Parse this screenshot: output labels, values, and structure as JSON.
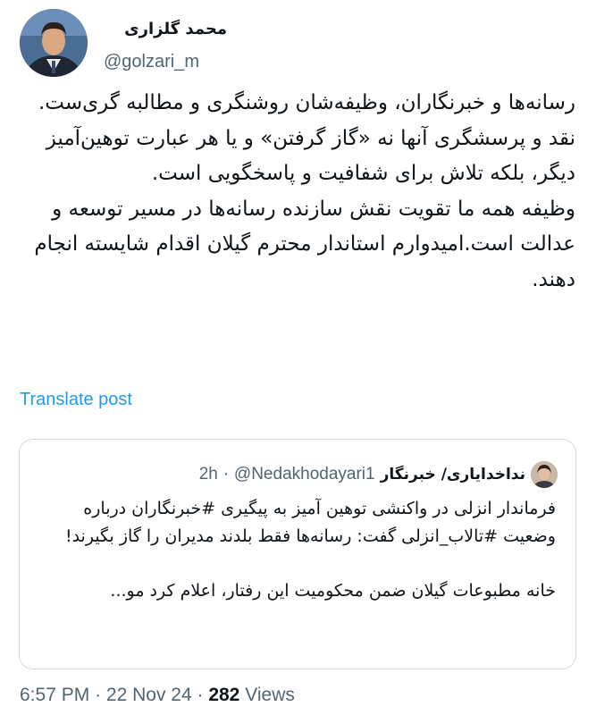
{
  "author": {
    "name": "محمد گلزاری",
    "handle": "@golzari_m"
  },
  "tweet": {
    "paragraph1": "رسانه‌ها و خبرنگاران، وظیفه‌شان روشنگری و مطالبه گری‌ست. نقد و پرسشگری آنها نه «گاز گرفتن» و یا هر عبارت توهین‌آمیز دیگر، بلکه تلاش برای شفافیت و پاسخگویی است.",
    "paragraph2": "وظیفه همه ما تقویت نقش سازنده رسانه‌ها در مسیر توسعه و عدالت است.امیدوارم استاندار محترم گیلان اقدام شایسته انجام دهند."
  },
  "translate_label": "Translate post",
  "quoted": {
    "name": "ندا‌خدایاری/ خبرنگار",
    "handle": "@Nedakhodayari1",
    "separator": "·",
    "time": "2h",
    "paragraph1": "فرماندار انزلی در واکنشی توهین آمیز به پیگیری #خبرنگاران درباره وضعیت #تالاب_انزلی گفت: رسانه‌ها فقط بلدند مدیران را گاز بگیرند!",
    "paragraph2": "خانه مطبوعات گیلان ضمن محکومیت این رفتار، اعلام کرد مو..."
  },
  "meta": {
    "time": "6:57 PM",
    "separator": "·",
    "date": "22 Nov 24",
    "views_count": "282",
    "views_label": "Views"
  },
  "colors": {
    "link": "#1d9bf0",
    "secondary_text": "#536471",
    "border": "#cfd9de"
  }
}
